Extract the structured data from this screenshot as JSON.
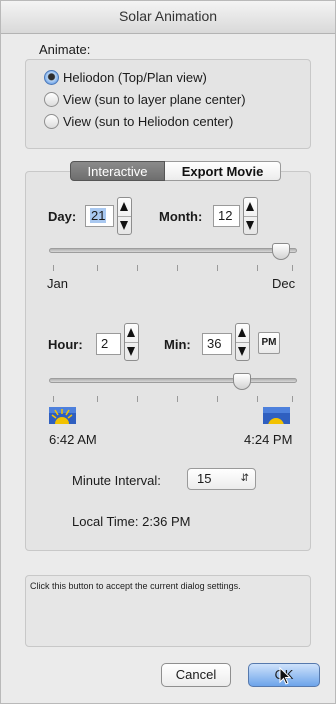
{
  "window": {
    "title": "Solar Animation"
  },
  "animate": {
    "label": "Animate:",
    "options": [
      {
        "label": "Heliodon (Top/Plan view)",
        "selected": true
      },
      {
        "label": "View (sun to layer plane center)",
        "selected": false
      },
      {
        "label": "View (sun to Heliodon center)",
        "selected": false
      }
    ]
  },
  "tabs": {
    "interactive": "Interactive",
    "export": "Export Movie",
    "selected": "Interactive"
  },
  "date": {
    "day_label": "Day:",
    "day_value": "21",
    "month_label": "Month:",
    "month_value": "12",
    "slider_start": "Jan",
    "slider_end": "Dec",
    "slider_fraction": 0.97
  },
  "time": {
    "hour_label": "Hour:",
    "hour_value": "2",
    "min_label": "Min:",
    "min_value": "36",
    "ampm": "PM",
    "slider_fraction": 0.8,
    "sunrise": "6:42 AM",
    "sunset": "4:24 PM"
  },
  "interval": {
    "label": "Minute Interval:",
    "value": "15"
  },
  "local_time": "Local Time: 2:36 PM",
  "help_text": "Click this button to accept the current dialog settings.",
  "buttons": {
    "cancel": "Cancel",
    "ok": "OK"
  },
  "colors": {
    "accent": "#6da4ea",
    "selected_tab": "#6e6e6e",
    "sun": "#f2c200"
  }
}
